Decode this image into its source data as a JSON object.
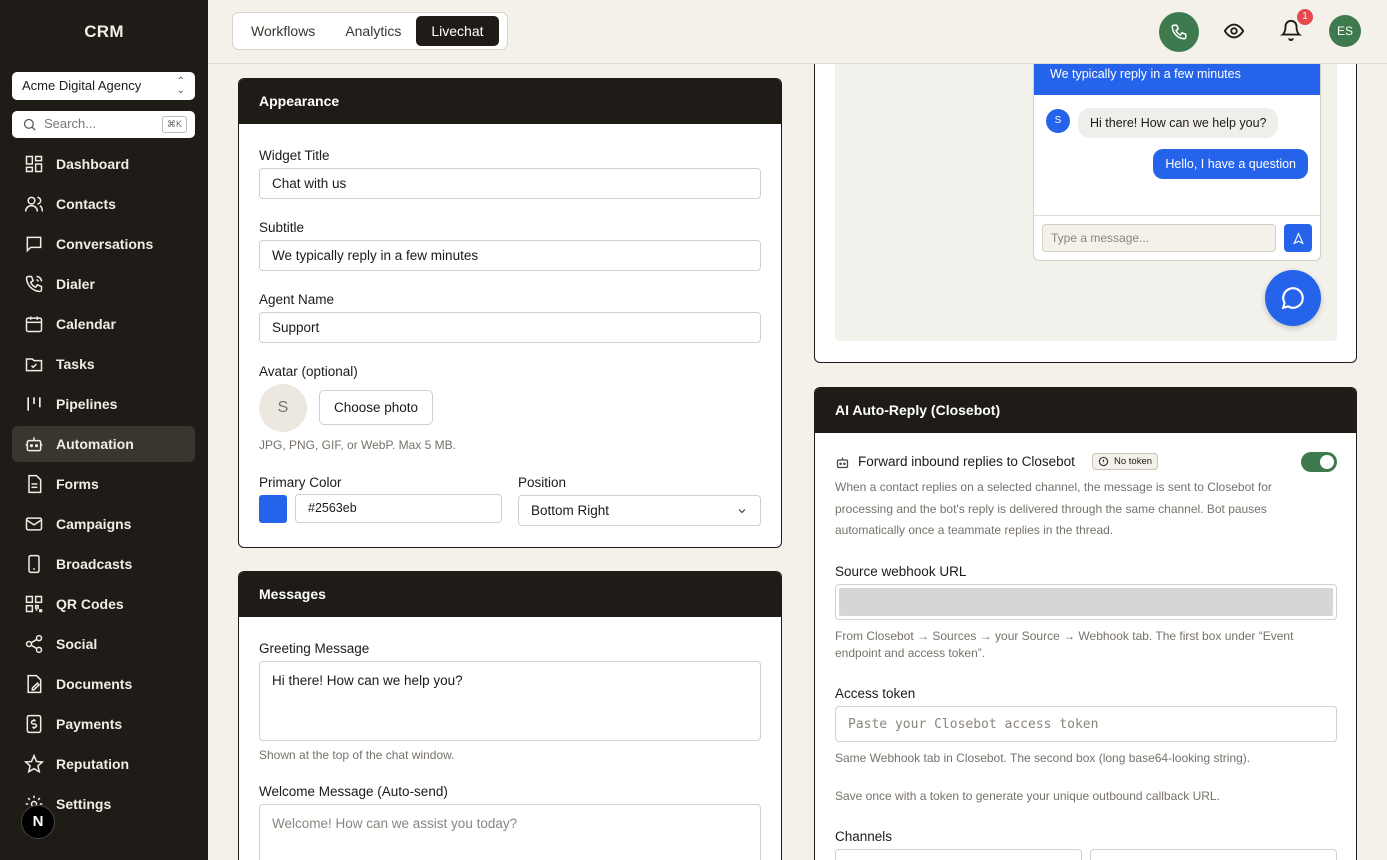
{
  "app": {
    "brand": "CRM"
  },
  "sidebar": {
    "org": "Acme Digital Agency",
    "search_placeholder": "Search...",
    "search_shortcut": "⌘K",
    "items": [
      {
        "label": "Dashboard",
        "icon": "dashboard-icon"
      },
      {
        "label": "Contacts",
        "icon": "contacts-icon"
      },
      {
        "label": "Conversations",
        "icon": "conversations-icon"
      },
      {
        "label": "Dialer",
        "icon": "dialer-icon"
      },
      {
        "label": "Calendar",
        "icon": "calendar-icon"
      },
      {
        "label": "Tasks",
        "icon": "tasks-icon"
      },
      {
        "label": "Pipelines",
        "icon": "pipelines-icon"
      },
      {
        "label": "Automation",
        "icon": "automation-icon",
        "active": true
      },
      {
        "label": "Forms",
        "icon": "forms-icon"
      },
      {
        "label": "Campaigns",
        "icon": "campaigns-icon"
      },
      {
        "label": "Broadcasts",
        "icon": "broadcasts-icon"
      },
      {
        "label": "QR Codes",
        "icon": "qr-codes-icon"
      },
      {
        "label": "Social",
        "icon": "social-icon"
      },
      {
        "label": "Documents",
        "icon": "documents-icon"
      },
      {
        "label": "Payments",
        "icon": "payments-icon"
      },
      {
        "label": "Reputation",
        "icon": "reputation-icon"
      },
      {
        "label": "Settings",
        "icon": "settings-icon"
      }
    ],
    "bottom_badge": "N"
  },
  "topbar": {
    "tabs": [
      {
        "label": "Workflows"
      },
      {
        "label": "Analytics"
      },
      {
        "label": "Livechat",
        "active": true
      }
    ],
    "notification_count": "1",
    "user_initials": "ES"
  },
  "appearance": {
    "title": "Appearance",
    "widget_title_label": "Widget Title",
    "widget_title_value": "Chat with us",
    "subtitle_label": "Subtitle",
    "subtitle_value": "We typically reply in a few minutes",
    "agent_name_label": "Agent Name",
    "agent_name_value": "Support",
    "avatar_label": "Avatar (optional)",
    "avatar_initial": "S",
    "choose_photo": "Choose photo",
    "avatar_hint": "JPG, PNG, GIF, or WebP. Max 5 MB.",
    "primary_color_label": "Primary Color",
    "primary_color_value": "#2563eb",
    "position_label": "Position",
    "position_value": "Bottom Right"
  },
  "messages": {
    "title": "Messages",
    "greeting_label": "Greeting Message",
    "greeting_value": "Hi there! How can we help you?",
    "greeting_hint": "Shown at the top of the chat window.",
    "welcome_label": "Welcome Message (Auto-send)",
    "welcome_placeholder": "Welcome! How can we assist you today?"
  },
  "preview": {
    "subtitle": "We typically reply in a few minutes",
    "bot_initial": "S",
    "bot_message": "Hi there! How can we help you?",
    "user_message": "Hello, I have a question",
    "input_placeholder": "Type a message..."
  },
  "closebot": {
    "title": "AI Auto-Reply (Closebot)",
    "forward_label": "Forward inbound replies to Closebot",
    "token_chip": "No token",
    "toggle_on": true,
    "description": "When a contact replies on a selected channel, the message is sent to Closebot for processing and the bot's reply is delivered through the same channel. Bot pauses automatically once a teammate replies in the thread.",
    "webhook_label": "Source webhook URL",
    "webhook_hint": "From Closebot → Sources → your Source → Webhook tab. The first box under “Event endpoint and access token”.",
    "token_label": "Access token",
    "token_placeholder": "Paste your Closebot access token",
    "token_hint": "Same Webhook tab in Closebot. The second box (long base64-looking string).",
    "save_hint": "Save once with a token to generate your unique outbound callback URL.",
    "channels_label": "Channels"
  },
  "colors": {
    "primary": "#2563eb",
    "dark": "#1f1c17",
    "green": "#3f7a4f",
    "background": "#f4f1ea"
  }
}
